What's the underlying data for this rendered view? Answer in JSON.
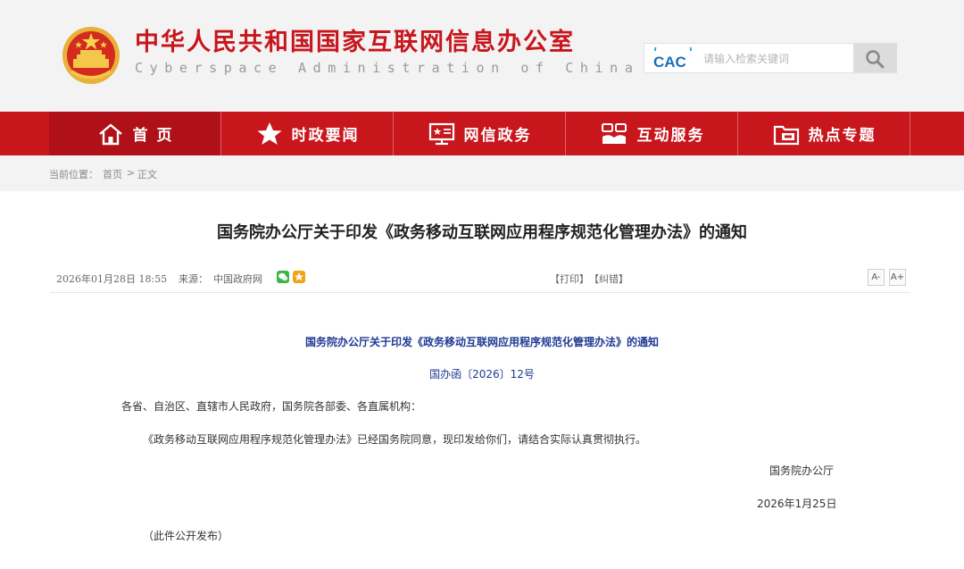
{
  "header": {
    "site_name_cn": "中华人民共和国国家互联网信息办公室",
    "site_name_en": "Cyberspace Administration of China",
    "cac_logo": "CAC",
    "search_placeholder": "请输入检索关键词",
    "emblem_icon": "national-emblem-icon",
    "search_icon": "search-icon"
  },
  "nav": {
    "items": [
      {
        "label": "首 页",
        "icon": "home-icon"
      },
      {
        "label": "时政要闻",
        "icon": "star-icon"
      },
      {
        "label": "网信政务",
        "icon": "monitor-icon"
      },
      {
        "label": "互动服务",
        "icon": "handshake-icon"
      },
      {
        "label": "热点专题",
        "icon": "folder-icon"
      }
    ]
  },
  "breadcrumb": {
    "prefix": "当前位置：",
    "home": "首页",
    "separator": ">",
    "current": "正文"
  },
  "article": {
    "title": "国务院办公厅关于印发《政务移动互联网应用程序规范化管理办法》的通知",
    "date": "2026年01月28日  18:55",
    "source_label": "来源：",
    "source": "中国政府网",
    "print": "【打印】",
    "correct": "【纠错】",
    "font_smaller": "A-",
    "font_larger": "A+",
    "doc_title": "国务院办公厅关于印发《政务移动互联网应用程序规范化管理办法》的通知",
    "doc_number": "国办函〔2026〕12号",
    "recipients": "各省、自治区、直辖市人民政府，国务院各部委、各直属机构：",
    "body": "《政务移动互联网应用程序规范化管理办法》已经国务院同意，现印发给你们，请结合实际认真贯彻执行。",
    "signature": "国务院办公厅",
    "sign_date": "2026年1月25日",
    "note": "（此件公开发布）"
  },
  "colors": {
    "brand_red": "#c8161d",
    "nav_active": "#b01017",
    "doc_blue": "#1f3a93",
    "header_bg": "#f3f3f3"
  }
}
